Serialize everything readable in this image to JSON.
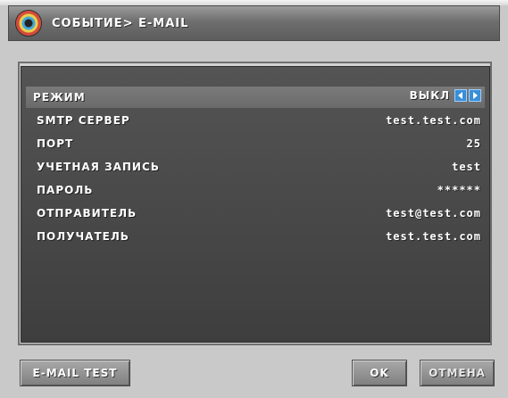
{
  "header": {
    "title": "СОБЫТИЕ> E-MAIL",
    "logo_icon": "globe-logo-icon"
  },
  "settings": [
    {
      "label": "РЕЖИМ",
      "value": "ВЫКЛ",
      "selected": true
    },
    {
      "label": "SMTP СЕРВЕР",
      "value": "test.test.com"
    },
    {
      "label": "ПОРТ",
      "value": "25"
    },
    {
      "label": "УЧЕТНАЯ ЗАПИСЬ",
      "value": "test"
    },
    {
      "label": "ПАРОЛЬ",
      "value": "******"
    },
    {
      "label": "ОТПРАВИТЕЛЬ",
      "value": "test@test.com"
    },
    {
      "label": "ПОЛУЧАТЕЛЬ",
      "value": "test.test.com"
    }
  ],
  "buttons": {
    "email_test": "E-MAIL TEST",
    "ok": "OK",
    "cancel": "ОТМЕНА"
  },
  "colors": {
    "accent": "#3a8ed8",
    "panel": "#4a4a4a",
    "selection": "#727272"
  }
}
